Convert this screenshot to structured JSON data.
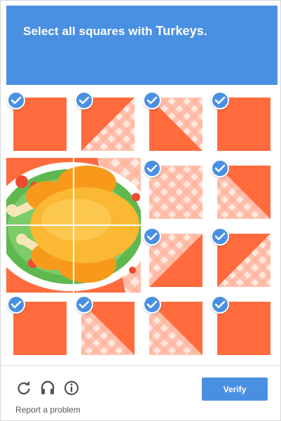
{
  "header": {
    "prompt_prefix": "Select all squares with ",
    "target": "Turkeys",
    "prompt_suffix": ".",
    "background": "#4a90e2"
  },
  "grid": {
    "rows": 4,
    "cols": 4,
    "tiles": [
      {
        "row": 0,
        "col": 0,
        "selected": true,
        "content": "plain"
      },
      {
        "row": 0,
        "col": 1,
        "selected": true,
        "content": "plaid-triangle-top"
      },
      {
        "row": 0,
        "col": 2,
        "selected": true,
        "content": "plaid-triangle-left"
      },
      {
        "row": 0,
        "col": 3,
        "selected": true,
        "content": "plain"
      },
      {
        "row": 1,
        "col": 0,
        "selected": false,
        "content": "turkey"
      },
      {
        "row": 1,
        "col": 1,
        "selected": false,
        "content": "turkey"
      },
      {
        "row": 1,
        "col": 2,
        "selected": true,
        "content": "plaid-full"
      },
      {
        "row": 1,
        "col": 3,
        "selected": true,
        "content": "plaid-triangle-right"
      },
      {
        "row": 2,
        "col": 0,
        "selected": false,
        "content": "turkey"
      },
      {
        "row": 2,
        "col": 1,
        "selected": false,
        "content": "turkey"
      },
      {
        "row": 2,
        "col": 2,
        "selected": true,
        "content": "plaid-triangle-bottom"
      },
      {
        "row": 2,
        "col": 3,
        "selected": true,
        "content": "plaid-triangle-topleft"
      },
      {
        "row": 3,
        "col": 0,
        "selected": true,
        "content": "plain"
      },
      {
        "row": 3,
        "col": 1,
        "selected": true,
        "content": "plaid-triangle-bottomleft"
      },
      {
        "row": 3,
        "col": 2,
        "selected": true,
        "content": "plaid-triangle-bottomleft"
      },
      {
        "row": 3,
        "col": 3,
        "selected": true,
        "content": "plain"
      }
    ]
  },
  "colors": {
    "tile_orange": "#ff6b3d",
    "plaid_light": "#ffe8e0",
    "plaid_mid": "#ffb49c",
    "check_blue": "#4a90e2",
    "turkey_yellow": "#fbb832",
    "turkey_orange": "#f79a1b",
    "plate_white": "#ffffff",
    "lettuce": "#5fb84f"
  },
  "footer": {
    "icons": [
      "reload-icon",
      "audio-icon",
      "info-icon"
    ],
    "report_link": "Report a problem",
    "verify_label": "Verify"
  }
}
